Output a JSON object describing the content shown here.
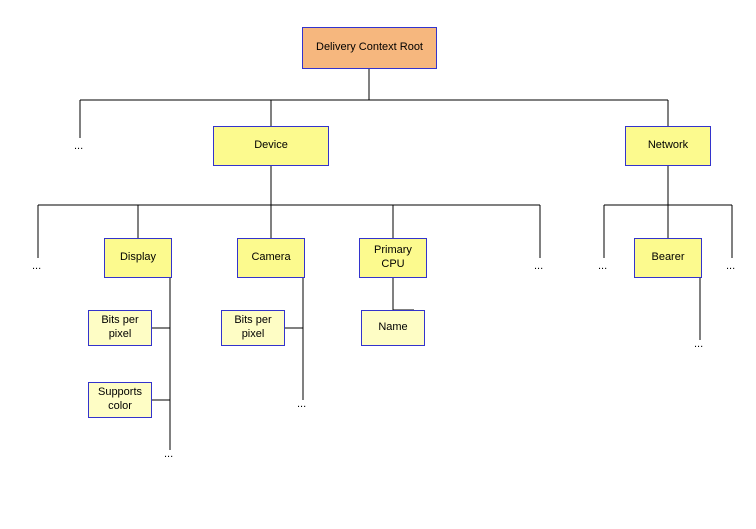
{
  "root": {
    "label": "Delivery Context Root"
  },
  "device": {
    "label": "Device"
  },
  "network": {
    "label": "Network"
  },
  "display": {
    "label": "Display"
  },
  "camera": {
    "label": "Camera"
  },
  "primary_cpu": {
    "label": "Primary CPU"
  },
  "bearer": {
    "label": "Bearer"
  },
  "display_bpp": {
    "label": "Bits per pixel"
  },
  "display_color": {
    "label": "Supports color"
  },
  "camera_bpp": {
    "label": "Bits per pixel"
  },
  "cpu_name": {
    "label": "Name"
  },
  "ellipsis": "...",
  "colors": {
    "root_fill": "#f6b77e",
    "mid_fill": "#fcfa8e",
    "leaf_fill": "#fefdc5",
    "border": "#3333cc"
  }
}
